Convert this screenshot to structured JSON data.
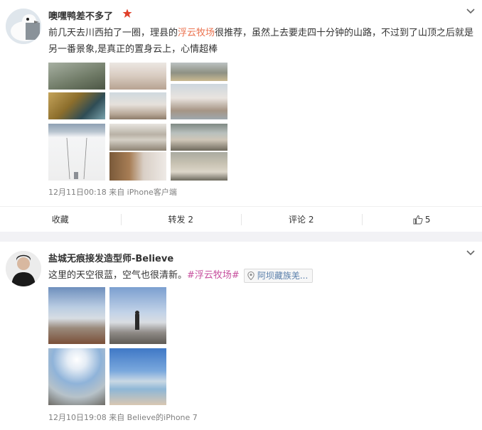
{
  "posts": [
    {
      "username": "噢嘿鸭差不多了",
      "text_before": "前几天去川西拍了一圈，理县的",
      "text_link": "浮云牧场",
      "text_after": "很推荐，虽然上去要走四十分钟的山路，不过到了山顶之后就是另一番景象,是真正的置身云上，心情超棒",
      "meta": "12月11日00:18 来自 iPhone客户端",
      "actions": {
        "favorite": "收藏",
        "repost": "转发 2",
        "comment": "评论 2",
        "like": "5"
      }
    },
    {
      "username": "盐城无痕接发造型师-Believe",
      "text": "这里的天空很蓝，空气也很清新。",
      "topic": "#浮云牧场#",
      "location": "阿坝藏族羌...",
      "meta": "12月10日19:08 来自 Believe的iPhone 7"
    }
  ],
  "icons": [
    "dove-avatar-icon",
    "star-badge-icon",
    "chevron-down-icon",
    "location-pin-icon",
    "thumbs-up-icon"
  ],
  "colors": {
    "link": "#eb7350",
    "topic": "#c7509e",
    "location_text": "#5a7fab",
    "meta": "#808080",
    "badge": "#e0402a"
  }
}
